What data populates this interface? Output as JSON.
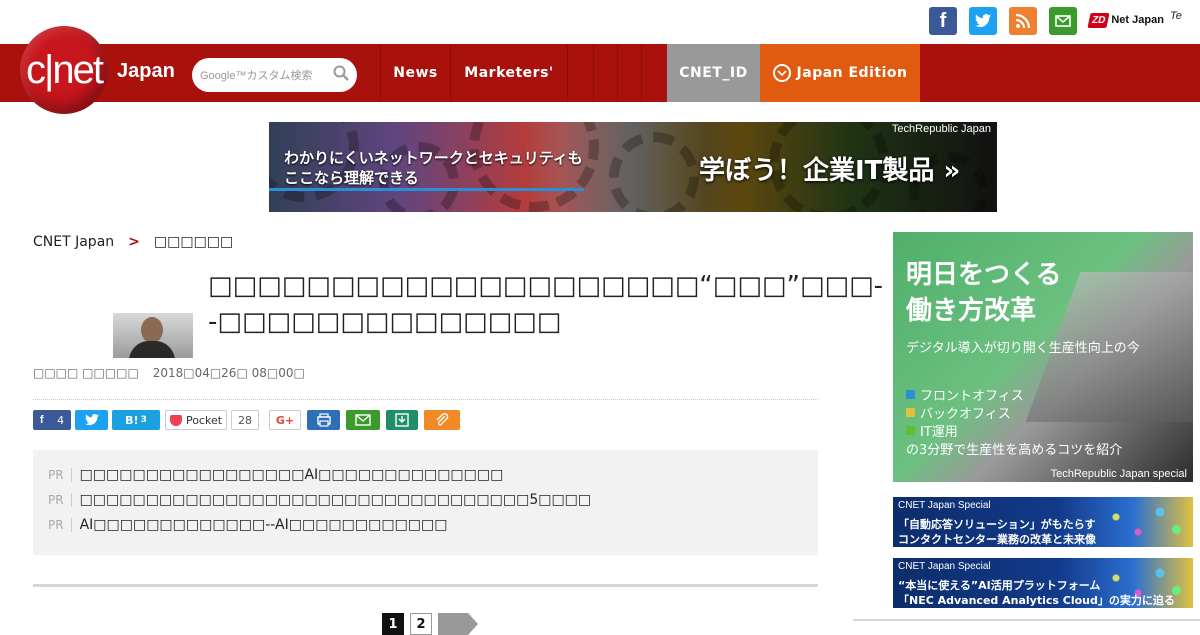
{
  "header": {
    "logo_text": "c|net",
    "logo_sub": "Japan",
    "search_placeholder": "Google™カスタム検索",
    "social": {
      "facebook": "f",
      "twitter": "t",
      "rss": "r",
      "mail": "m"
    },
    "zdnet_badge": "ZD",
    "zdnet_text": "Net Japan",
    "techrepublic_text": "Te"
  },
  "nav": {
    "items": [
      {
        "label": "News"
      },
      {
        "label": "Marketers'"
      },
      {
        "label": "CNET_ID"
      },
      {
        "label": "Japan Edition"
      }
    ]
  },
  "banner": {
    "line1": "わかりにくいネットワークとセキュリティも",
    "line2": "ここなら理解できる",
    "cta": "学ぼう！企業IT製品 »",
    "tag": "TechRepublic Japan"
  },
  "breadcrumb": {
    "home": "CNET Japan",
    "separator": ">",
    "current": "□□□□□□"
  },
  "article": {
    "title": "□□□□□□□□□□□□□□□□□□□□“□□□”□□□--□□□□□□□□□□□□□□",
    "author": "□□□□ □□□□□",
    "date": "2018□04□26□ 08□00□"
  },
  "share": {
    "facebook_count": "4",
    "hatena_label": "B!",
    "hatena_count": "3",
    "pocket_label": "Pocket",
    "pocket_count": "28",
    "gplus_label": "G+"
  },
  "pr": {
    "tag": "PR",
    "items": [
      "□□□□□□□□□□□□□□□□□AI□□□□□□□□□□□□□□",
      "□□□□□□□□□□□□□□□□□□□□□□□□□□□□□□□□□□5□□□□",
      "AI□□□□□□□□□□□□□--AI□□□□□□□□□□□□"
    ]
  },
  "pagination": {
    "page1": "1",
    "page2": "2"
  },
  "sidebar": {
    "ad1": {
      "headline1": "明日をつくる",
      "headline2": "働き方改革",
      "sub": "デジタル導入が切り開く生産性向上の今",
      "bullets": [
        "フロントオフィス",
        "バックオフィス",
        "IT運用"
      ],
      "bullet_colors": [
        "#2a8fd6",
        "#e0c040",
        "#5fc030"
      ],
      "tail": "の3分野で生産性を高めるコツを紹介",
      "footer": "TechRepublic Japan special"
    },
    "ad2": {
      "tag": "CNET Japan Special",
      "line1": "「自動応答ソリューション」がもたらす",
      "line2": "コンタクトセンター業務の改革と未来像"
    },
    "ad3": {
      "tag": "CNET Japan Special",
      "line1": "“本当に使える”AI活用プラットフォーム",
      "line2": "「NEC Advanced Analytics Cloud」の実力に迫る"
    }
  }
}
